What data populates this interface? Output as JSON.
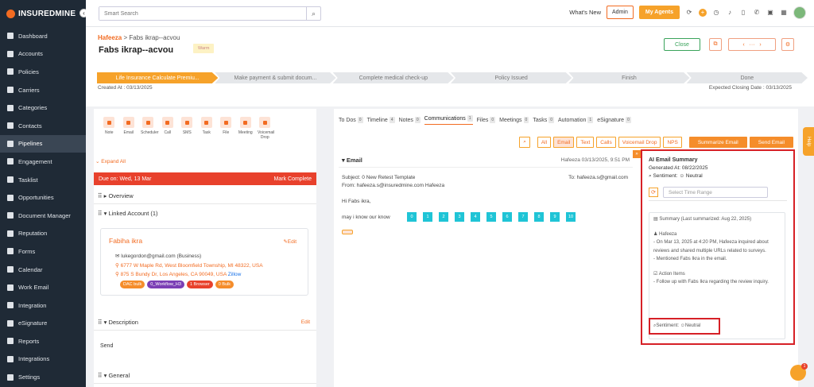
{
  "brand": {
    "name": "INSUREDMINE"
  },
  "sidebar": {
    "items": [
      {
        "label": "Dashboard"
      },
      {
        "label": "Accounts"
      },
      {
        "label": "Policies"
      },
      {
        "label": "Carriers"
      },
      {
        "label": "Categories"
      },
      {
        "label": "Contacts"
      },
      {
        "label": "Pipelines"
      },
      {
        "label": "Engagement"
      },
      {
        "label": "Tasklist"
      },
      {
        "label": "Opportunities"
      },
      {
        "label": "Document Manager"
      },
      {
        "label": "Reputation"
      },
      {
        "label": "Forms"
      },
      {
        "label": "Calendar"
      },
      {
        "label": "Work Email"
      },
      {
        "label": "Integration"
      },
      {
        "label": "eSignature"
      },
      {
        "label": "Reports"
      },
      {
        "label": "Integrations"
      },
      {
        "label": "Settings"
      }
    ]
  },
  "topbar": {
    "search_placeholder": "Smart Search",
    "whats_new": "What's New",
    "admin": "Admin",
    "my_agents": "My Agents"
  },
  "header": {
    "breadcrumb_root": "Hafeeza",
    "breadcrumb_sep": ">",
    "breadcrumb_current": "Fabs ikrap--acvou",
    "title": "Fabs ikrap--acvou",
    "warm": "Warm",
    "close": "Close",
    "created": "Created At : 03/13/2025",
    "closing": "Expected Closing Date : 03/13/2025"
  },
  "stages": [
    "Life Insurance Calculate Premiu...",
    "Make payment & submit docum...",
    "Complete medical check-up",
    "Policy Issued",
    "Finish",
    "Done"
  ],
  "left": {
    "actions": [
      "Note",
      "Email",
      "Scheduler",
      "Call",
      "SMS",
      "Task",
      "File",
      "Meeting",
      "Voicemail Drop"
    ],
    "expand_all": "Expand All",
    "due": "Due on: Wed, 13 Mar",
    "mark_complete": "Mark Complete",
    "overview": "Overview",
    "linked_account": "Linked Account (1)",
    "account_name": "Fabiha ikra",
    "edit": "Edit",
    "email": "lukegordon@gmail.com (Business)",
    "addr1": "6777 W Maple Rd, West Bloomfield Township, MI 48322, USA",
    "addr2": "875 S Bundy Dr, Los Angeles, CA 90049, USA",
    "zillow": "Zillow",
    "tags": [
      {
        "label": "DAC bulk",
        "color": "#f58d2b"
      },
      {
        "label": "0_Workflow_H3",
        "color": "#7b3fb5"
      },
      {
        "label": "1 Browser",
        "color": "#e8412c"
      },
      {
        "label": "0 Bulk",
        "color": "#f58d2b"
      }
    ],
    "description": "Description",
    "desc_value": "Send",
    "general": "General"
  },
  "right": {
    "tabs": [
      {
        "label": "To Dos",
        "count": "0"
      },
      {
        "label": "Timeline",
        "count": "4"
      },
      {
        "label": "Notes",
        "count": "0"
      },
      {
        "label": "Communications",
        "count": "1"
      },
      {
        "label": "Files",
        "count": "0"
      },
      {
        "label": "Meetings",
        "count": "0"
      },
      {
        "label": "Tasks",
        "count": "0"
      },
      {
        "label": "Automation",
        "count": "1"
      },
      {
        "label": "eSignature",
        "count": "0"
      }
    ],
    "filters": [
      "All",
      "Email",
      "Text",
      "Calls",
      "Voicemail Drop",
      "NPS"
    ],
    "summarize": "Summarize Email",
    "send": "Send Email",
    "email_title": "Email",
    "email_date": "Hafeeza 03/13/2025, 9:51 PM",
    "subject": "Subject: 0 New Retest Template",
    "to": "To: hafeeza.s@gmail.com",
    "from": "From: hafeeza.s@insuredmine.com Hafeeza",
    "greeting": "Hi Fabs ikra,",
    "question": "may i know our know",
    "nums": [
      "0",
      "1",
      "2",
      "3",
      "4",
      "5",
      "6",
      "7",
      "8",
      "9",
      "10"
    ]
  },
  "ai": {
    "title": "AI Email Summary",
    "generated": "Generated At: 08/22/2025",
    "sentiment": "Sentiment:",
    "sentiment_value": "Neutral",
    "range_placeholder": "Select Time Range",
    "summary_head": "Summary (Last summarized: Aug 22, 2025)",
    "person": "Hafeeza",
    "b1": "- On Mar 13, 2025 at 4:20 PM, Hafeeza inquired about reviews and shared multiple URLs related to surveys.",
    "b2": "- Mentioned Fabs Ikra in the email.",
    "action_head": "Action Items",
    "b3": "- Follow up with Fabs Ikra regarding the review inquiry.",
    "sent2": "Sentiment:",
    "sent2_value": "Neutral"
  },
  "help": "Help",
  "chat_badge": "1",
  "orange_badge": "»"
}
